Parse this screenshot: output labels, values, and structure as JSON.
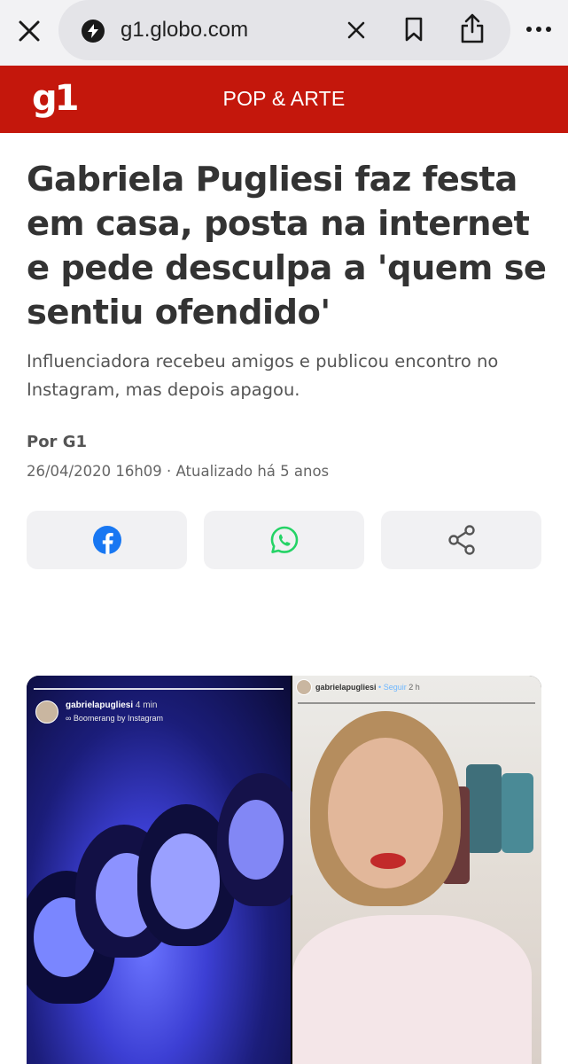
{
  "browser": {
    "url": "g1.globo.com",
    "close_icon": "close-icon",
    "site_icon": "lightning-icon",
    "clear_icon": "clear-icon",
    "bookmark_icon": "bookmark-icon",
    "share_icon": "share-icon",
    "more_icon": "more-icon"
  },
  "header": {
    "logo": "g1",
    "section": "POP & ARTE",
    "brand_color": "#c4170c"
  },
  "article": {
    "headline": "Gabriela Pugliesi faz festa em casa, posta na internet e pede desculpa a 'quem se sentiu ofendido'",
    "subhead": "Influenciadora recebeu amigos e publicou encontro no Instagram, mas depois apagou.",
    "byline": "Por G1",
    "dateline": "26/04/2020 16h09 · Atualizado há 5 anos"
  },
  "share_buttons": [
    {
      "icon": "facebook-icon",
      "color": "#1877f2"
    },
    {
      "icon": "whatsapp-icon",
      "color": "#25d366"
    },
    {
      "icon": "share-network-icon",
      "color": "#555555"
    }
  ],
  "photo": {
    "left_story": {
      "username": "gabrielapugliesi",
      "time": "4 min",
      "subtitle": "∞ Boomerang by Instagram"
    },
    "right_story": {
      "username": "gabrielapugliesi",
      "follow": "• Seguir",
      "time": "2 h"
    }
  }
}
